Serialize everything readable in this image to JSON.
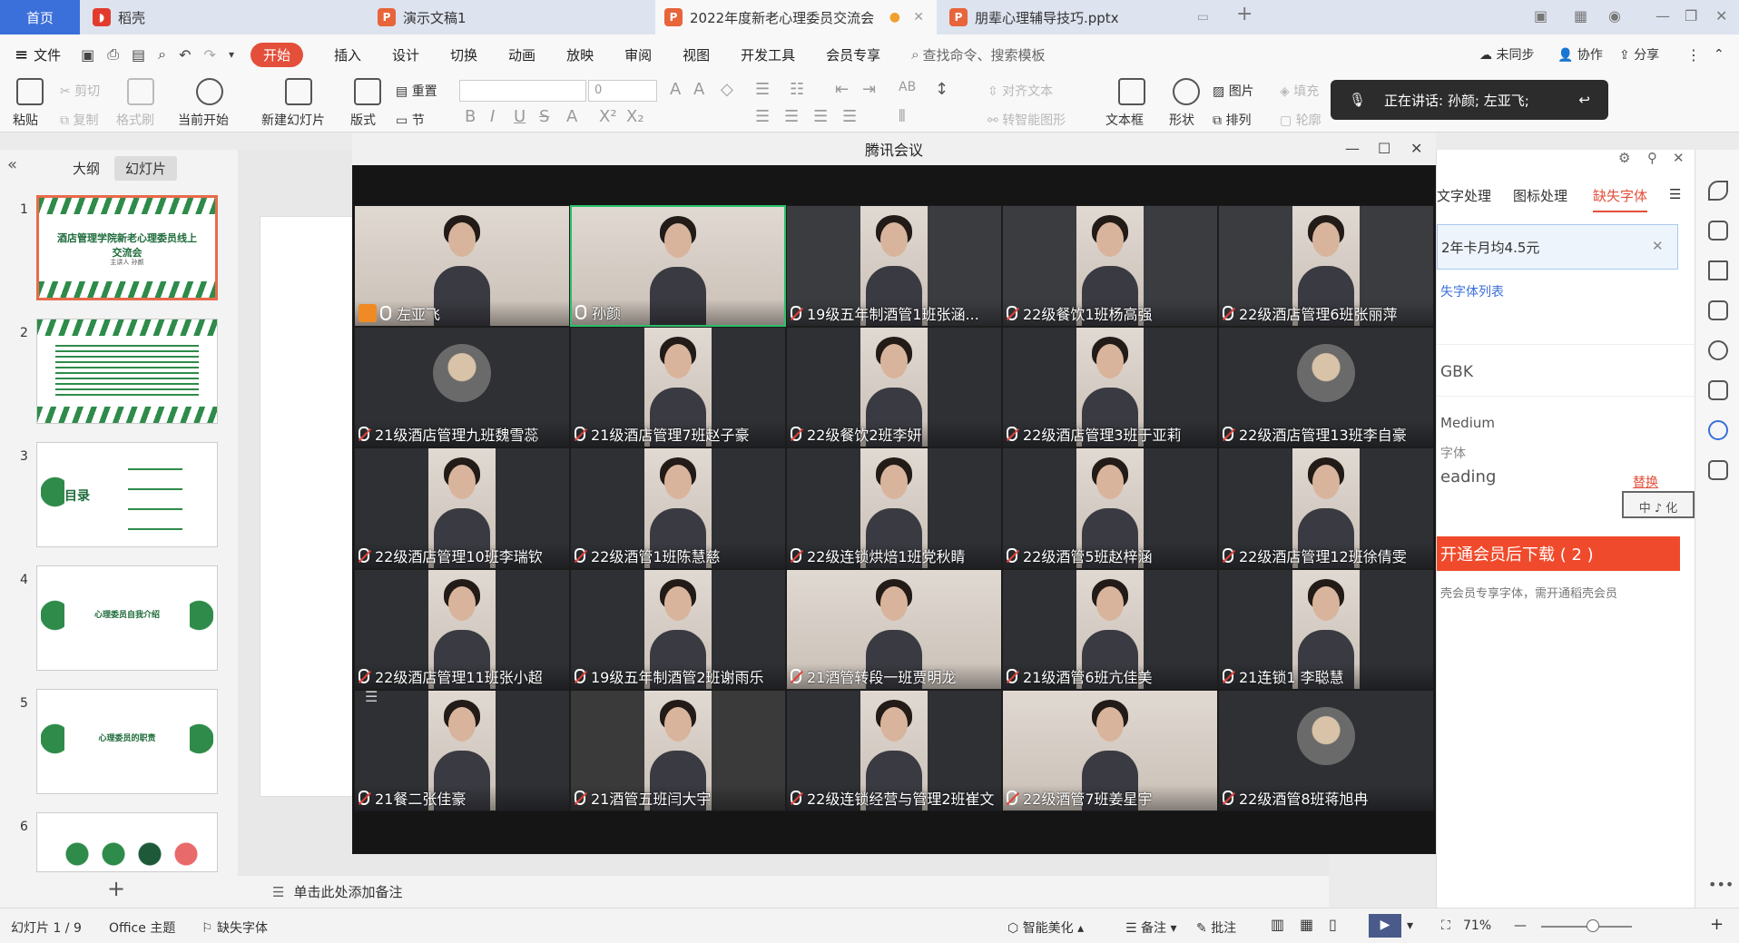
{
  "tabs": {
    "home": "首页",
    "wps": "稻壳",
    "doc1": "演示文稿1",
    "doc2": "2022年度新老心理委员交流会",
    "doc3": "朋辈心理辅导技巧.pptx"
  },
  "menu": {
    "file": "文件",
    "start": "开始",
    "items": [
      "插入",
      "设计",
      "切换",
      "动画",
      "放映",
      "审阅",
      "视图",
      "开发工具",
      "会员专享"
    ],
    "search": "查找命令、搜索模板",
    "sync": "未同步",
    "collab": "协作",
    "share": "分享"
  },
  "ribbon": {
    "paste": "粘贴",
    "cut": "剪切",
    "copy": "复制",
    "format_painter": "格式刷",
    "from_current": "当前开始",
    "new_slide": "新建幻灯片",
    "layout": "版式",
    "reset": "重置",
    "section": "节",
    "font_size": "0",
    "align_text": "对齐文本",
    "smart_art": "转智能图形",
    "textbox": "文本框",
    "shape": "形状",
    "picture": "图片",
    "arrange": "排列",
    "fill": "填充",
    "outline": "轮廓"
  },
  "speaker": {
    "text": "正在讲话: 孙颜; 左亚飞;"
  },
  "left_pane": {
    "tab_outline": "大纲",
    "tab_slides": "幻灯片",
    "slides": [
      {
        "num": "1",
        "title": "酒店管理学院新老心理委员线上交流会",
        "sub": "主讲人 孙颜"
      },
      {
        "num": "2",
        "title": ""
      },
      {
        "num": "3",
        "title": "目录"
      },
      {
        "num": "4",
        "title": "心理委员自我介绍"
      },
      {
        "num": "5",
        "title": "心理委员的职责"
      },
      {
        "num": "6",
        "title": ""
      }
    ]
  },
  "notes": "单击此处添加备注",
  "meeting": {
    "title": "腾讯会议",
    "participants": [
      {
        "name": "左亚飞",
        "mic": "on",
        "host": true
      },
      {
        "name": "孙颜",
        "mic": "on"
      },
      {
        "name": "19级五年制酒管1班张涵...",
        "mic": "muted"
      },
      {
        "name": "22级餐饮1班杨高强",
        "mic": "muted"
      },
      {
        "name": "22级酒店管理6班张丽萍",
        "mic": "muted"
      },
      {
        "name": "21级酒店管理九班魏雪蕊",
        "mic": "muted"
      },
      {
        "name": "21级酒店管理7班赵子豪",
        "mic": "muted"
      },
      {
        "name": "22级餐饮2班李妍",
        "mic": "muted"
      },
      {
        "name": "22级酒店管理3班于亚莉",
        "mic": "muted"
      },
      {
        "name": "22级酒店管理13班李自豪",
        "mic": "muted"
      },
      {
        "name": "22级酒店管理10班李瑞钦",
        "mic": "muted"
      },
      {
        "name": "22级酒管1班陈慧慈",
        "mic": "muted"
      },
      {
        "name": "22级连锁烘焙1班党秋睛",
        "mic": "muted"
      },
      {
        "name": "22级酒管5班赵梓涵",
        "mic": "muted"
      },
      {
        "name": "22级酒店管理12班徐倩雯",
        "mic": "muted"
      },
      {
        "name": "22级酒店管理11班张小超",
        "mic": "muted"
      },
      {
        "name": "19级五年制酒管2班谢雨乐",
        "mic": "muted"
      },
      {
        "name": "21酒管转段一班贾明龙",
        "mic": "muted"
      },
      {
        "name": "21级酒管6班亢佳美",
        "mic": "muted"
      },
      {
        "name": "21连锁1 李聪慧",
        "mic": "muted"
      },
      {
        "name": "21餐二张佳豪",
        "mic": "muted"
      },
      {
        "name": "21酒管五班闫大宇",
        "mic": "muted"
      },
      {
        "name": "22级连锁经营与管理2班崔文",
        "mic": "muted"
      },
      {
        "name": "22级酒管7班姜星宇",
        "mic": "muted"
      },
      {
        "name": "22级酒管8班蒋旭冉",
        "mic": "muted"
      }
    ]
  },
  "right_pane": {
    "tab1": "文字处理",
    "tab2": "图标处理",
    "tab3": "缺失字体",
    "item1": "2年卡月均4.5元",
    "list_link": "失字体列表",
    "font1": "GBK",
    "font2": "Medium",
    "font3": "字体",
    "font4": "eading",
    "replace": "替换",
    "download": "开通会员后下载 ( 2 )",
    "note": "壳会员专享字体，需开通稻壳会员"
  },
  "status": {
    "slide": "幻灯片 1 / 9",
    "theme": "Office 主题",
    "missing_font": "缺失字体",
    "beautify": "智能美化",
    "notes": "备注",
    "comment": "批注",
    "zoom": "71%"
  },
  "colors": {
    "accent": "#e34f3a",
    "wps_blue": "#3b6fd9",
    "active_speaker": "#2cbf6a"
  }
}
